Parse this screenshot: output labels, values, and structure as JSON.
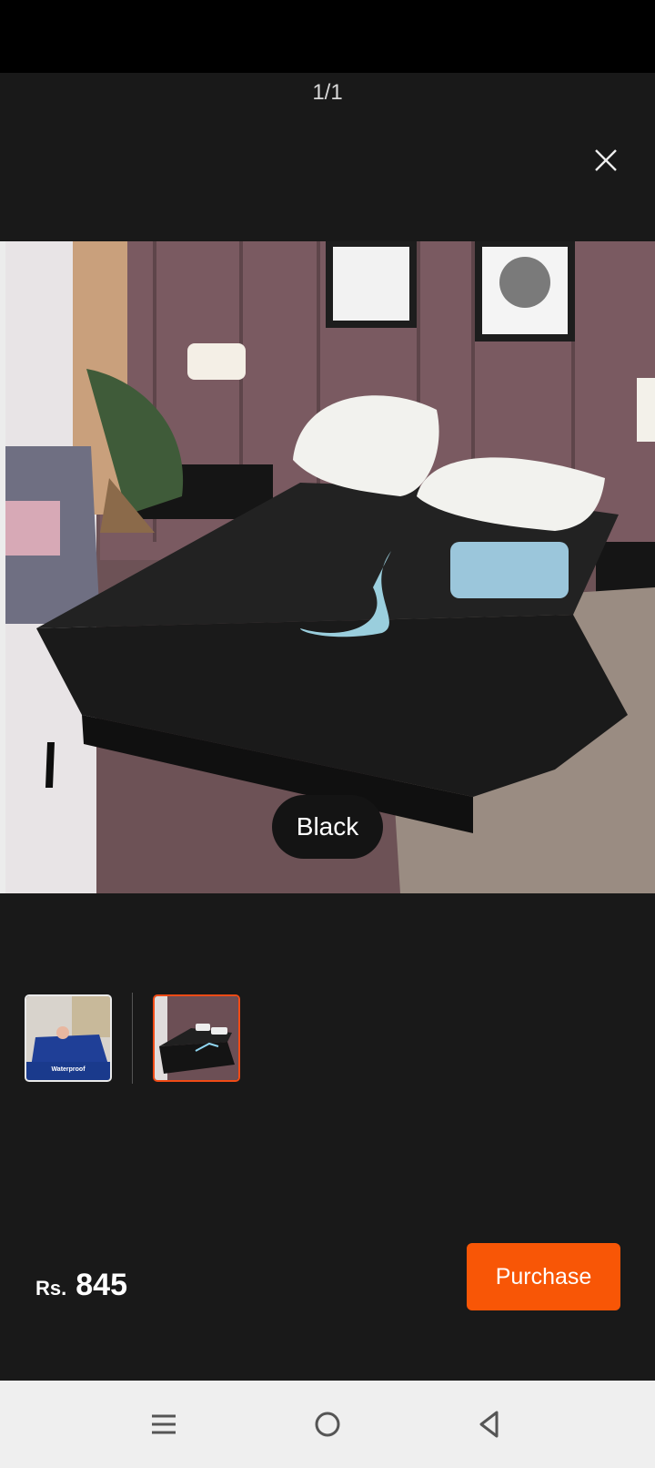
{
  "header": {
    "counter": "1/1"
  },
  "icons": {
    "close": "close-icon",
    "menu": "menu-icon",
    "home": "home-icon",
    "back": "back-icon"
  },
  "gallery": {
    "variant_label": "Black",
    "main_image": "bed-black-waterproof-sheet-image",
    "thumbnails": [
      {
        "name": "blue-waterproof-cover-thumbnail",
        "caption": "Waterproof",
        "selected": false
      },
      {
        "name": "black-bed-sheet-thumbnail",
        "selected": true
      }
    ]
  },
  "footer": {
    "currency": "Rs.",
    "price": "845",
    "purchase_label": "Purchase"
  },
  "colors": {
    "accent": "#f85606",
    "selected_border": "#f04b16",
    "background": "#191919"
  }
}
